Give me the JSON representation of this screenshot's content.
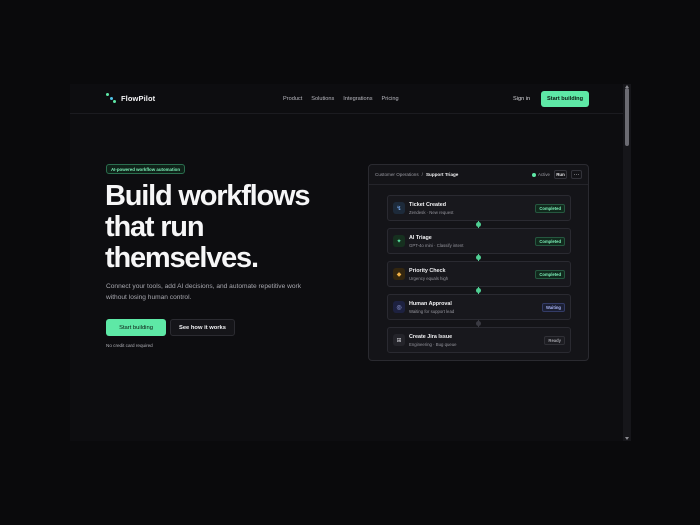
{
  "nav": {
    "brand": "FlowPilot",
    "links": [
      "Product",
      "Solutions",
      "Integrations",
      "Pricing"
    ],
    "signin": "Sign in",
    "cta": "Start building"
  },
  "hero": {
    "badge": "AI-powered workflow automation",
    "title_lines": [
      "Build workflows",
      "that run",
      "themselves."
    ],
    "subtitle": "Connect your tools, add AI decisions, and automate repetitive work without losing human control.",
    "primary_cta": "Start building",
    "secondary_cta": "See how it works",
    "note": "No credit card required"
  },
  "panel": {
    "breadcrumb": [
      "Customer Operations",
      "/",
      "Support Triage"
    ],
    "status": "Active",
    "run_label": "Run",
    "more_label": "···",
    "steps": [
      {
        "title": "Ticket Created",
        "desc": "Zendesk · New request",
        "badge": "Completed",
        "icon": "lightning-icon"
      },
      {
        "title": "AI Triage",
        "desc": "GPT-4o mini · Classify intent",
        "badge": "Completed",
        "icon": "sparkle-icon"
      },
      {
        "title": "Priority Check",
        "desc": "Urgency equals high",
        "badge": "Completed",
        "icon": "diamond-icon"
      },
      {
        "title": "Human Approval",
        "desc": "Waiting for support lead",
        "badge": "Waiting",
        "icon": "check-circle-icon"
      },
      {
        "title": "Create Jira Issue",
        "desc": "Engineering · Bug queue",
        "badge": "Ready",
        "icon": "grid-icon"
      }
    ]
  },
  "colors": {
    "accent": "#5ee8a6",
    "background": "#0d0d10",
    "panel": "#141418",
    "waiting": "#a9b4f4"
  }
}
